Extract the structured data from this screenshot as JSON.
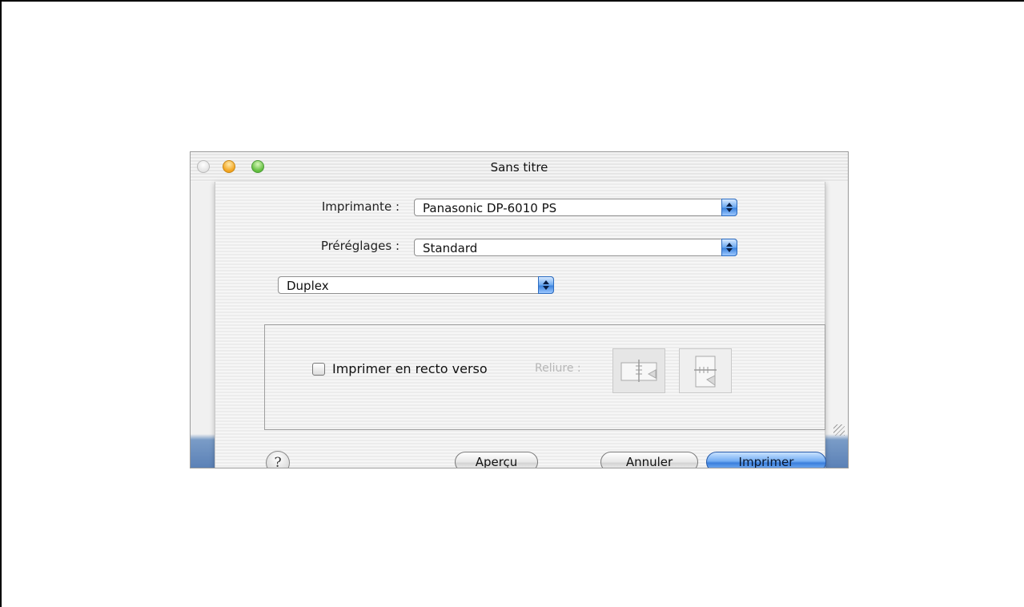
{
  "window": {
    "title": "Sans titre"
  },
  "form": {
    "printer_label": "Imprimante :",
    "printer_value": "Panasonic DP-6010 PS",
    "presets_label": "Préréglages :",
    "presets_value": "Standard",
    "panel_value": "Duplex"
  },
  "duplex": {
    "checkbox_label": "Imprimer en recto verso",
    "checkbox_checked": false,
    "binding_label": "Reliure :"
  },
  "buttons": {
    "help": "?",
    "preview": "Aperçu",
    "cancel": "Annuler",
    "print": "Imprimer"
  },
  "colors": {
    "accent_blue": "#3b7fdc",
    "traffic_minimize": "#f2a31e",
    "traffic_zoom": "#5fbd3c"
  }
}
